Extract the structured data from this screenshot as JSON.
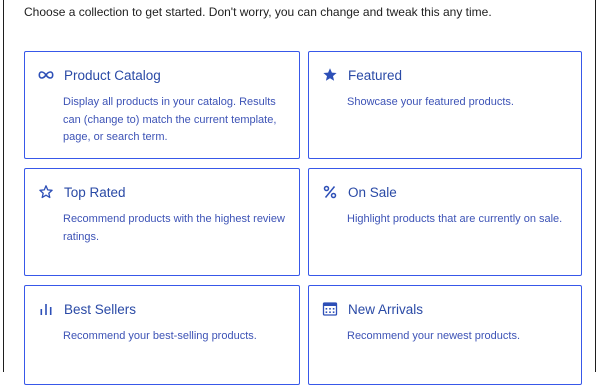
{
  "intro_text": "Choose a collection to get started. Don't worry, you can change and tweak this any time.",
  "colors": {
    "accent": "#3858e9",
    "title": "#2a4aa6",
    "description": "#3d53b6",
    "text": "#1e1e1e"
  },
  "collections": [
    {
      "icon": "infinity-icon",
      "title": "Product Catalog",
      "description": "Display all products in your catalog. Results can (change to) match the current template, page, or search term."
    },
    {
      "icon": "star-filled-icon",
      "title": "Featured",
      "description": "Showcase your featured products."
    },
    {
      "icon": "star-outline-icon",
      "title": "Top Rated",
      "description": "Recommend products with the highest review ratings."
    },
    {
      "icon": "percent-icon",
      "title": "On Sale",
      "description": "Highlight products that are currently on sale."
    },
    {
      "icon": "bar-chart-icon",
      "title": "Best Sellers",
      "description": "Recommend your best-selling products."
    },
    {
      "icon": "calendar-icon",
      "title": "New Arrivals",
      "description": "Recommend your newest products."
    }
  ]
}
